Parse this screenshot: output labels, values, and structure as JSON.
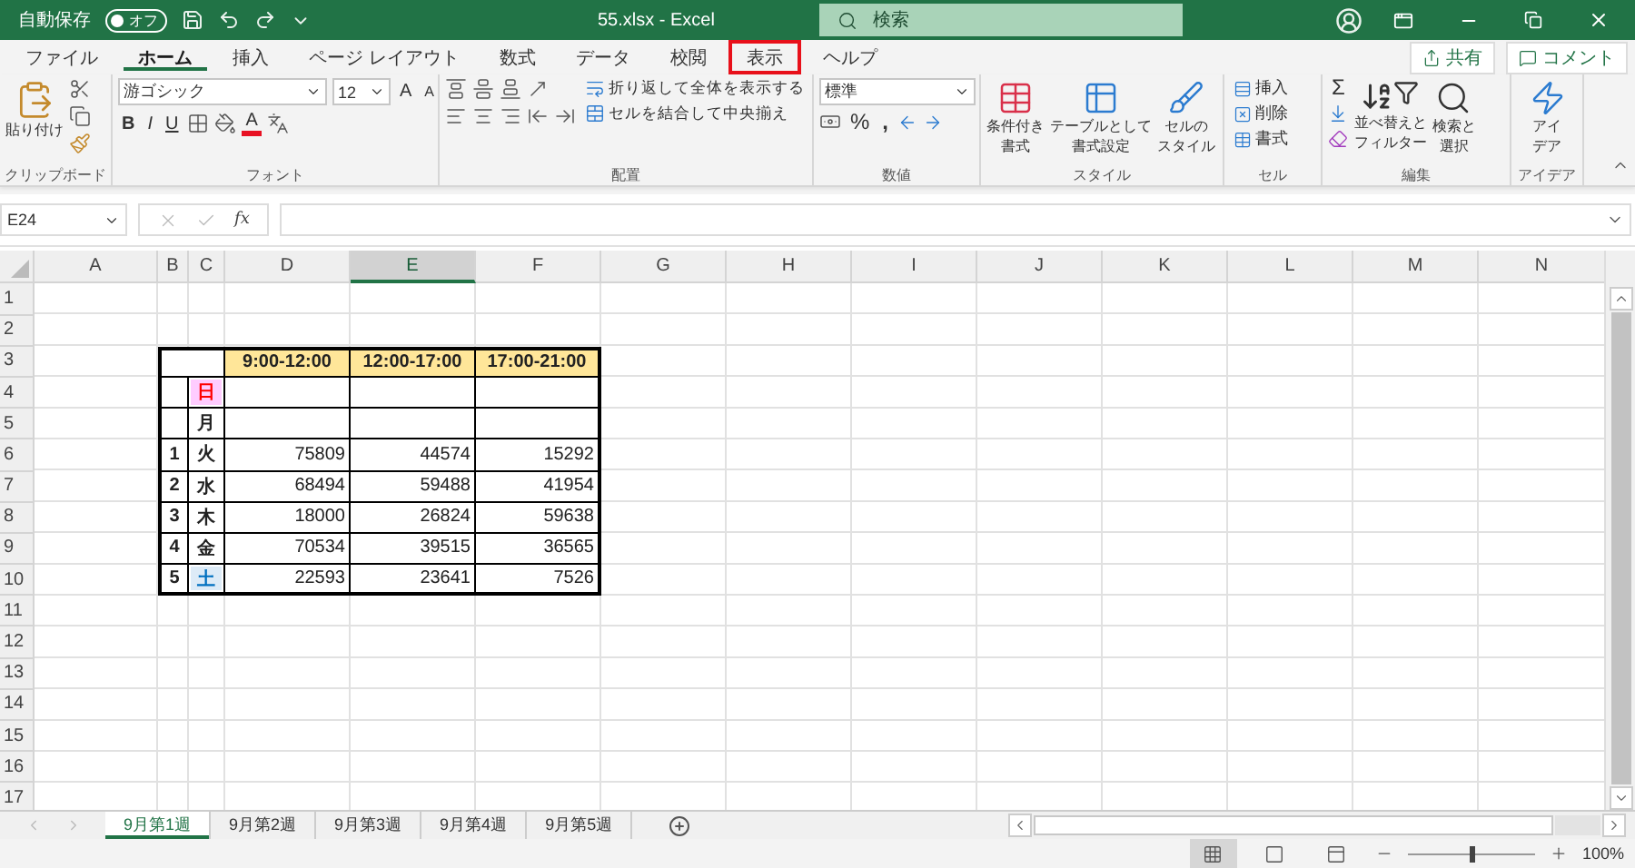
{
  "title_bar": {
    "autosave_label": "自動保存",
    "autosave_toggle": {
      "label": "オフ",
      "on": false
    },
    "filename": "55.xlsx  -  Excel",
    "search_placeholder": "検索"
  },
  "ribbon_tabs": [
    {
      "label": "ファイル",
      "selected": false,
      "highlighted": false
    },
    {
      "label": "ホーム",
      "selected": true,
      "highlighted": false
    },
    {
      "label": "挿入",
      "selected": false,
      "highlighted": false
    },
    {
      "label": "ページ レイアウト",
      "selected": false,
      "highlighted": false
    },
    {
      "label": "数式",
      "selected": false,
      "highlighted": false
    },
    {
      "label": "データ",
      "selected": false,
      "highlighted": false
    },
    {
      "label": "校閲",
      "selected": false,
      "highlighted": false
    },
    {
      "label": "表示",
      "selected": false,
      "highlighted": true
    },
    {
      "label": "ヘルプ",
      "selected": false,
      "highlighted": false
    }
  ],
  "share_button": "共有",
  "comment_button": "コメント",
  "ribbon": {
    "clipboard": {
      "paste": "貼り付け",
      "label": "クリップボード"
    },
    "font": {
      "name": "游ゴシック",
      "size": "12",
      "grow": "A",
      "shrink": "A",
      "bold": "B",
      "italic": "I",
      "underline": "U",
      "text_color": "A",
      "label": "フォント"
    },
    "alignment": {
      "wrap": "折り返して全体を表示する",
      "merge": "セルを結合して中央揃え",
      "label": "配置"
    },
    "number": {
      "format": "標準",
      "percent": "%",
      "comma": ",",
      "label": "数値"
    },
    "styles": {
      "buttons": [
        [
          "条件付き",
          "書式"
        ],
        [
          "テーブルとして",
          "書式設定"
        ],
        [
          "セルの",
          "スタイル"
        ]
      ],
      "label": "スタイル"
    },
    "cells": {
      "buttons": [
        "挿入",
        "削除",
        "書式"
      ],
      "label": "セル"
    },
    "editing": {
      "sum": "Σ",
      "buttons": [
        [
          "並べ替えと",
          "フィルター"
        ],
        [
          "検索と",
          "選択"
        ]
      ],
      "label": "編集"
    },
    "ideas": {
      "button": [
        "アイ",
        "デア"
      ],
      "label": "アイデア"
    }
  },
  "formula_bar": {
    "name_box": "E24",
    "fx": "fx"
  },
  "sheet": {
    "columns": [
      {
        "label": "A",
        "selected": false
      },
      {
        "label": "B",
        "selected": false
      },
      {
        "label": "C",
        "selected": false
      },
      {
        "label": "D",
        "selected": false
      },
      {
        "label": "E",
        "selected": true
      },
      {
        "label": "F",
        "selected": false
      },
      {
        "label": "G",
        "selected": false
      },
      {
        "label": "H",
        "selected": false
      },
      {
        "label": "I",
        "selected": false
      },
      {
        "label": "J",
        "selected": false
      },
      {
        "label": "K",
        "selected": false
      },
      {
        "label": "L",
        "selected": false
      },
      {
        "label": "M",
        "selected": false
      },
      {
        "label": "N",
        "selected": false
      }
    ],
    "rows": [
      "1",
      "2",
      "3",
      "4",
      "5",
      "6",
      "7",
      "8",
      "9",
      "10",
      "11",
      "12",
      "13",
      "14",
      "15",
      "16",
      "17"
    ],
    "table": [
      [
        {
          "kind": "corner"
        },
        {
          "kind": "header",
          "text": "9:00-12:00"
        },
        {
          "kind": "header",
          "text": "12:00-17:00"
        },
        {
          "kind": "header",
          "text": "17:00-21:00"
        }
      ],
      [
        {
          "kind": "blank"
        },
        {
          "kind": "sunday",
          "text": "日"
        },
        {
          "kind": "blank"
        },
        {
          "kind": "blank"
        },
        {
          "kind": "blank"
        }
      ],
      [
        {
          "kind": "blank"
        },
        {
          "kind": "day",
          "text": "月"
        },
        {
          "kind": "blank"
        },
        {
          "kind": "blank"
        },
        {
          "kind": "blank"
        }
      ],
      [
        {
          "kind": "index",
          "text": "1"
        },
        {
          "kind": "day",
          "text": "火"
        },
        {
          "kind": "number",
          "text": "75809"
        },
        {
          "kind": "number",
          "text": "44574"
        },
        {
          "kind": "number",
          "text": "15292"
        }
      ],
      [
        {
          "kind": "index",
          "text": "2"
        },
        {
          "kind": "day",
          "text": "水"
        },
        {
          "kind": "number",
          "text": "68494"
        },
        {
          "kind": "number",
          "text": "59488"
        },
        {
          "kind": "number",
          "text": "41954"
        }
      ],
      [
        {
          "kind": "index",
          "text": "3"
        },
        {
          "kind": "day",
          "text": "木"
        },
        {
          "kind": "number",
          "text": "18000"
        },
        {
          "kind": "number",
          "text": "26824"
        },
        {
          "kind": "number",
          "text": "59638"
        }
      ],
      [
        {
          "kind": "index",
          "text": "4"
        },
        {
          "kind": "day",
          "text": "金"
        },
        {
          "kind": "number",
          "text": "70534"
        },
        {
          "kind": "number",
          "text": "39515"
        },
        {
          "kind": "number",
          "text": "36565"
        }
      ],
      [
        {
          "kind": "index",
          "text": "5"
        },
        {
          "kind": "saturday",
          "text": "土"
        },
        {
          "kind": "number",
          "text": "22593"
        },
        {
          "kind": "number",
          "text": "23641"
        },
        {
          "kind": "number",
          "text": "7526"
        }
      ]
    ]
  },
  "sheet_tabs": [
    {
      "label": "9月第1週",
      "selected": true
    },
    {
      "label": "9月第2週",
      "selected": false
    },
    {
      "label": "9月第3週",
      "selected": false
    },
    {
      "label": "9月第4週",
      "selected": false
    },
    {
      "label": "9月第5週",
      "selected": false
    }
  ],
  "status_bar": {
    "views": [
      {
        "kind": "normal",
        "selected": true
      },
      {
        "kind": "page-layout",
        "selected": false
      },
      {
        "kind": "page-break",
        "selected": false
      }
    ],
    "zoom": {
      "level": 0.5,
      "reading": "100%"
    }
  }
}
